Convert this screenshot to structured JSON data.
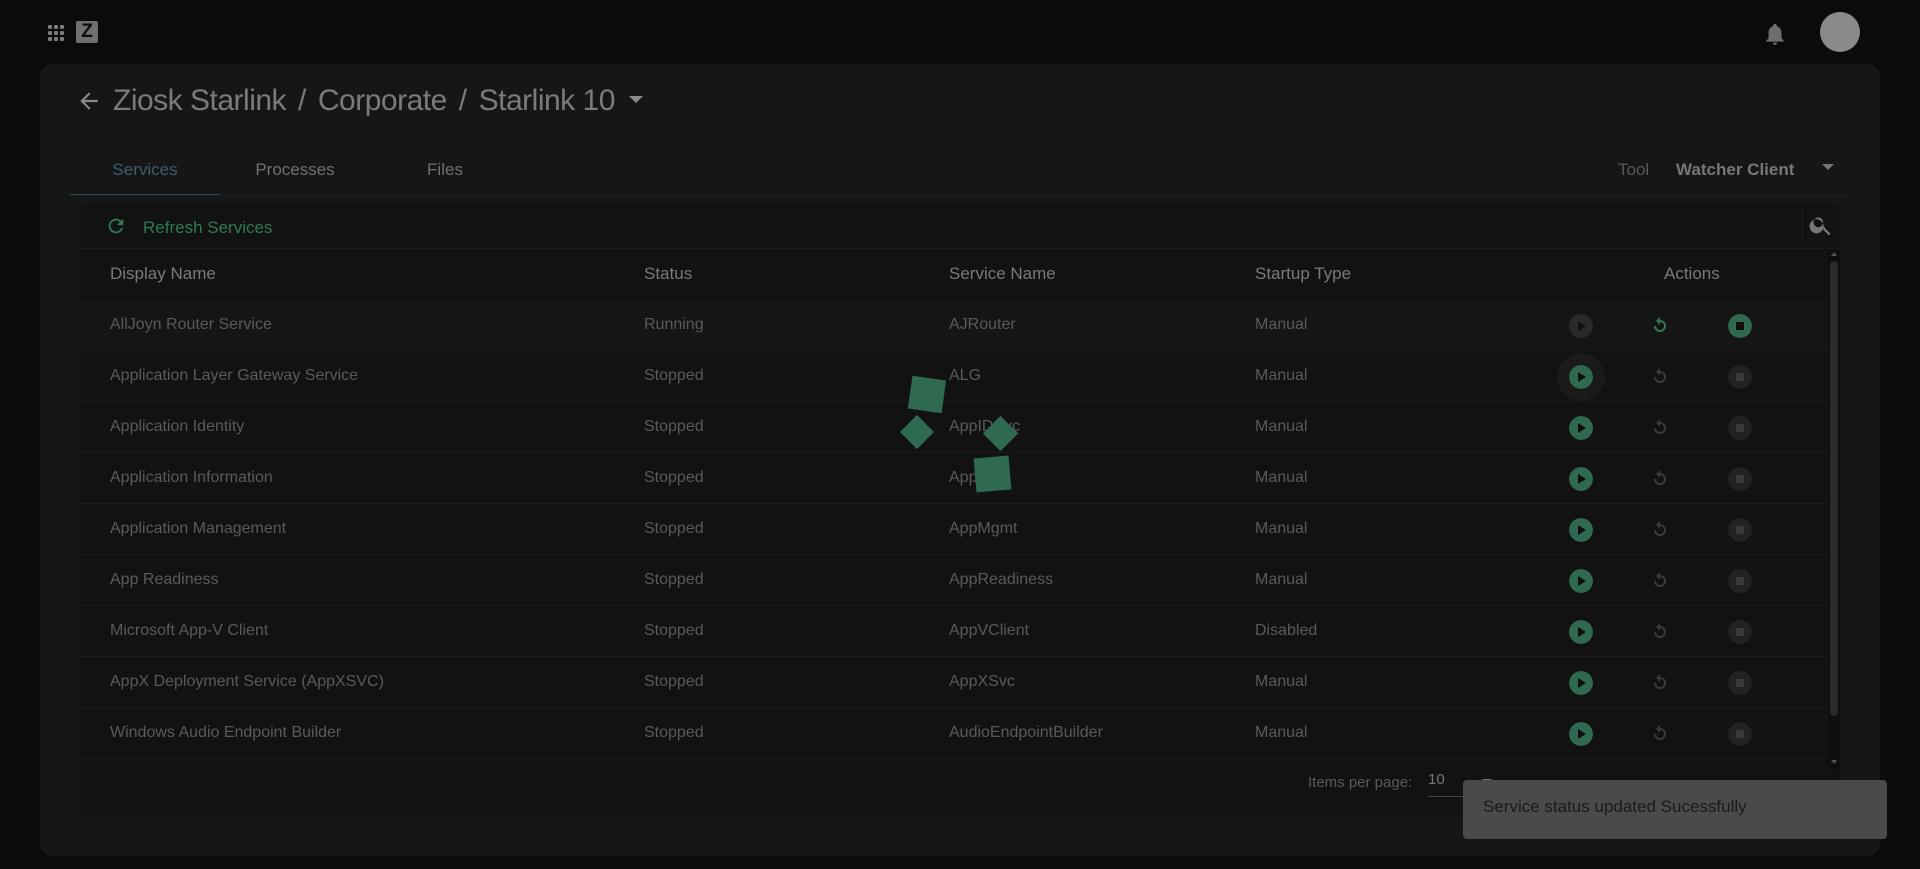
{
  "header": {
    "logo_text": "Z",
    "apps_icon": "apps-grid-icon",
    "notification_icon": "bell-icon",
    "avatar_icon": "avatar"
  },
  "breadcrumb": {
    "items": [
      "Ziosk Starlink",
      "Corporate",
      "Starlink 10"
    ],
    "separator": "/"
  },
  "tabs": [
    {
      "label": "Services",
      "active": true
    },
    {
      "label": "Processes",
      "active": false
    },
    {
      "label": "Files",
      "active": false
    }
  ],
  "tool": {
    "label": "Tool",
    "value": "Watcher Client"
  },
  "toolbar": {
    "refresh_label": "Refresh Services",
    "refresh_icon": "refresh-icon",
    "search_icon": "search-icon"
  },
  "table": {
    "columns": [
      "Display Name",
      "Status",
      "Service Name",
      "Startup Type",
      "Actions"
    ],
    "rows": [
      {
        "display_name": "AllJoyn Router Service",
        "status": "Running",
        "service_name": "AJRouter",
        "startup_type": "Manual"
      },
      {
        "display_name": "Application Layer Gateway Service",
        "status": "Stopped",
        "service_name": "ALG",
        "startup_type": "Manual"
      },
      {
        "display_name": "Application Identity",
        "status": "Stopped",
        "service_name": "AppIDSvc",
        "startup_type": "Manual"
      },
      {
        "display_name": "Application Information",
        "status": "Stopped",
        "service_name": "Appinfo",
        "startup_type": "Manual"
      },
      {
        "display_name": "Application Management",
        "status": "Stopped",
        "service_name": "AppMgmt",
        "startup_type": "Manual"
      },
      {
        "display_name": "App Readiness",
        "status": "Stopped",
        "service_name": "AppReadiness",
        "startup_type": "Manual"
      },
      {
        "display_name": "Microsoft App-V Client",
        "status": "Stopped",
        "service_name": "AppVClient",
        "startup_type": "Disabled"
      },
      {
        "display_name": "AppX Deployment Service (AppXSVC)",
        "status": "Stopped",
        "service_name": "AppXSvc",
        "startup_type": "Manual"
      },
      {
        "display_name": "Windows Audio Endpoint Builder",
        "status": "Stopped",
        "service_name": "AudioEndpointBuilder",
        "startup_type": "Manual"
      }
    ]
  },
  "paginator": {
    "label": "Items per page:",
    "value": "10"
  },
  "snackbar": {
    "message": "Service status updated Sucessfully"
  },
  "colors": {
    "accent_green": "#2f7a55",
    "active_green_fill": "#2f6a50",
    "inactive_gray": "#3a3a3a",
    "tab_active": "#3c5f6e"
  }
}
